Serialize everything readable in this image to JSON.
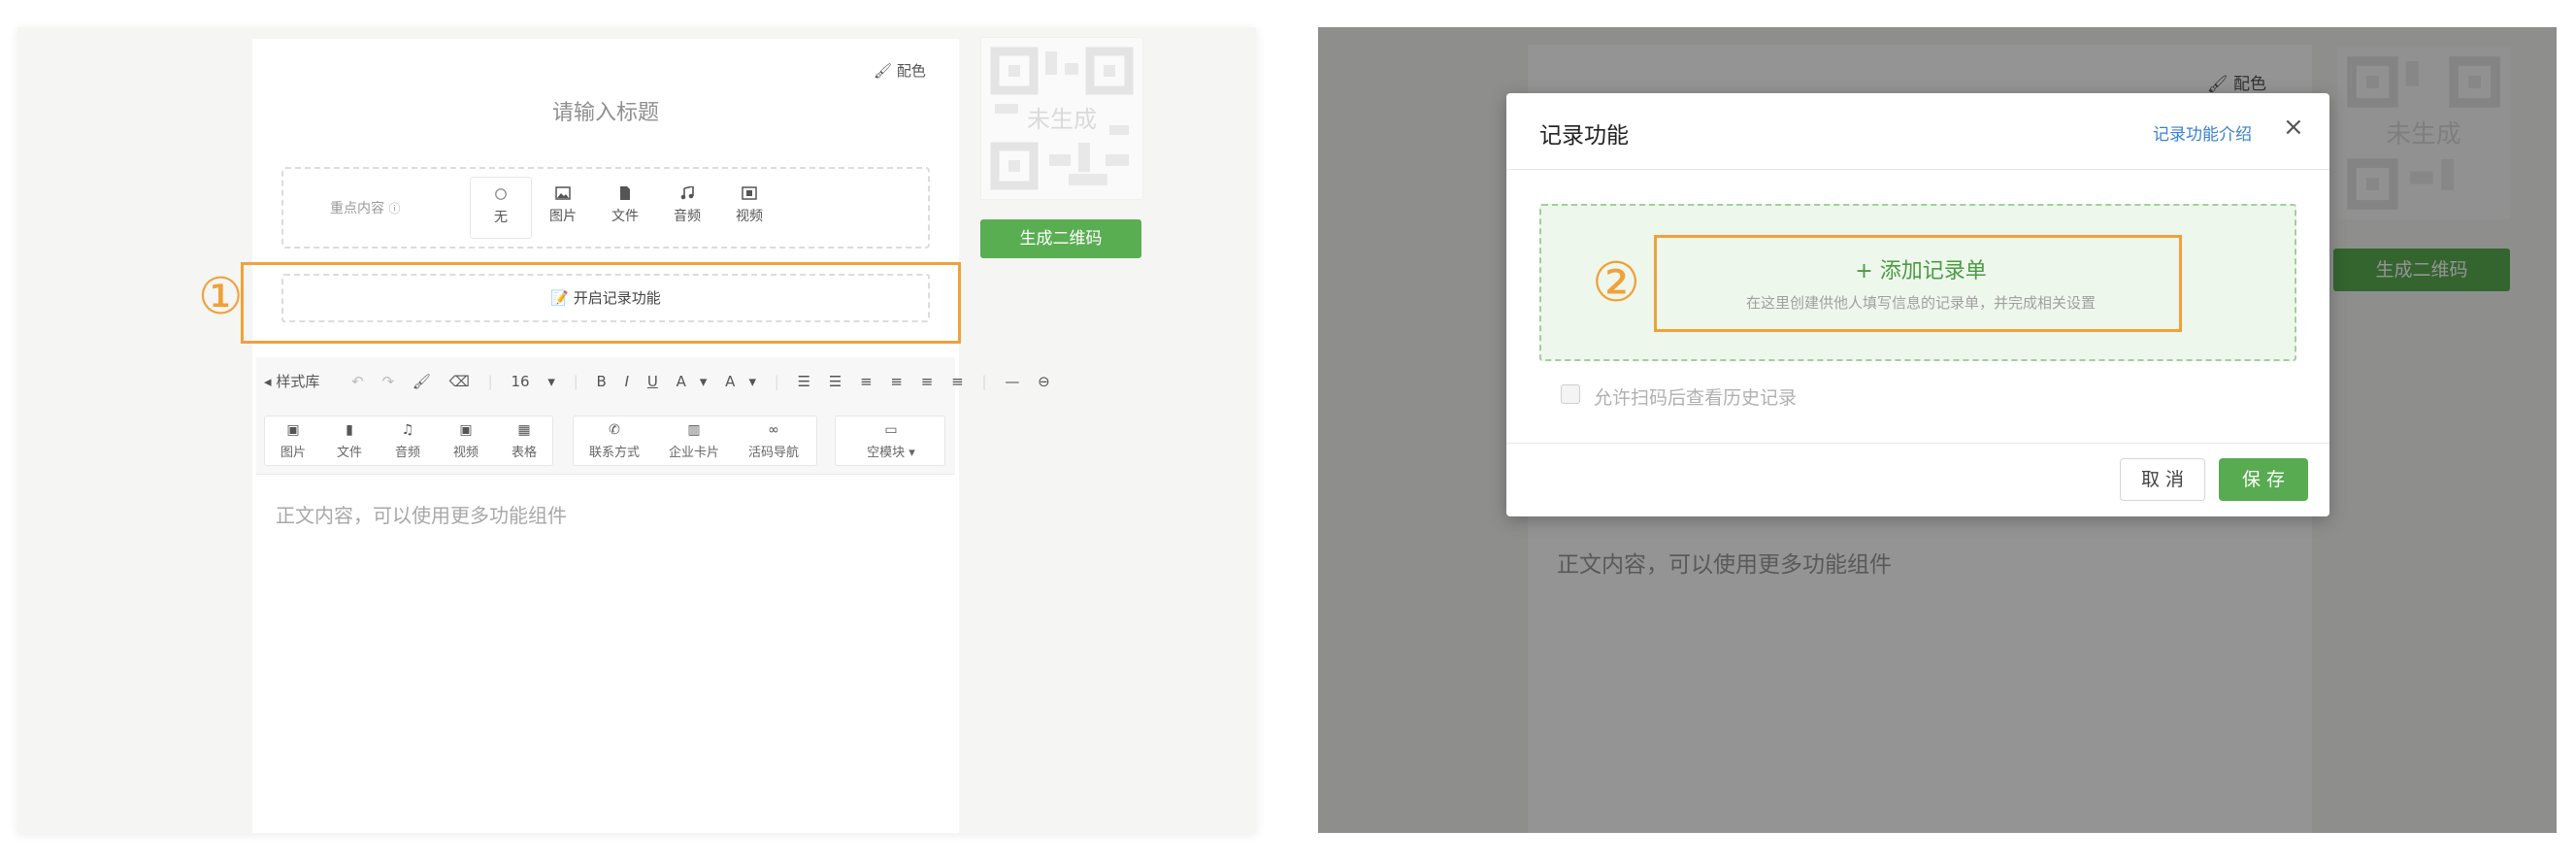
{
  "left": {
    "color_link": "配色",
    "title_placeholder": "请输入标题",
    "key_content": {
      "label": "重点内容",
      "options": [
        "无",
        "图片",
        "文件",
        "音频",
        "视频"
      ]
    },
    "record_button": "开启记录功能",
    "step_marker": "①",
    "toolbar": {
      "style_lib": "样式库",
      "font_size": "16",
      "bold": "B",
      "italic": "I",
      "underline": "U",
      "font_color": "A",
      "highlight": "A",
      "items": [
        "图片",
        "文件",
        "音频",
        "视频",
        "表格",
        "联系方式",
        "企业卡片",
        "活码导航",
        "空模块"
      ]
    },
    "body_placeholder": "正文内容，可以使用更多功能组件",
    "qr_status": "未生成",
    "generate_button": "生成二维码"
  },
  "right": {
    "color_link": "配色",
    "qr_status": "未生成",
    "generate_button": "生成二维码",
    "body_placeholder": "正文内容，可以使用更多功能组件",
    "modal": {
      "title": "记录功能",
      "intro_link": "记录功能介绍",
      "close": "×",
      "add_title": "+ 添加记录单",
      "add_desc": "在这里创建供他人填写信息的记录单，并完成相关设置",
      "step_marker": "②",
      "checkbox_label": "允许扫码后查看历史记录",
      "cancel": "取 消",
      "save": "保 存"
    }
  },
  "colors": {
    "brand_green": "#5aae52",
    "annotation_orange": "#f0a139",
    "link_blue": "#3a7fd0"
  }
}
